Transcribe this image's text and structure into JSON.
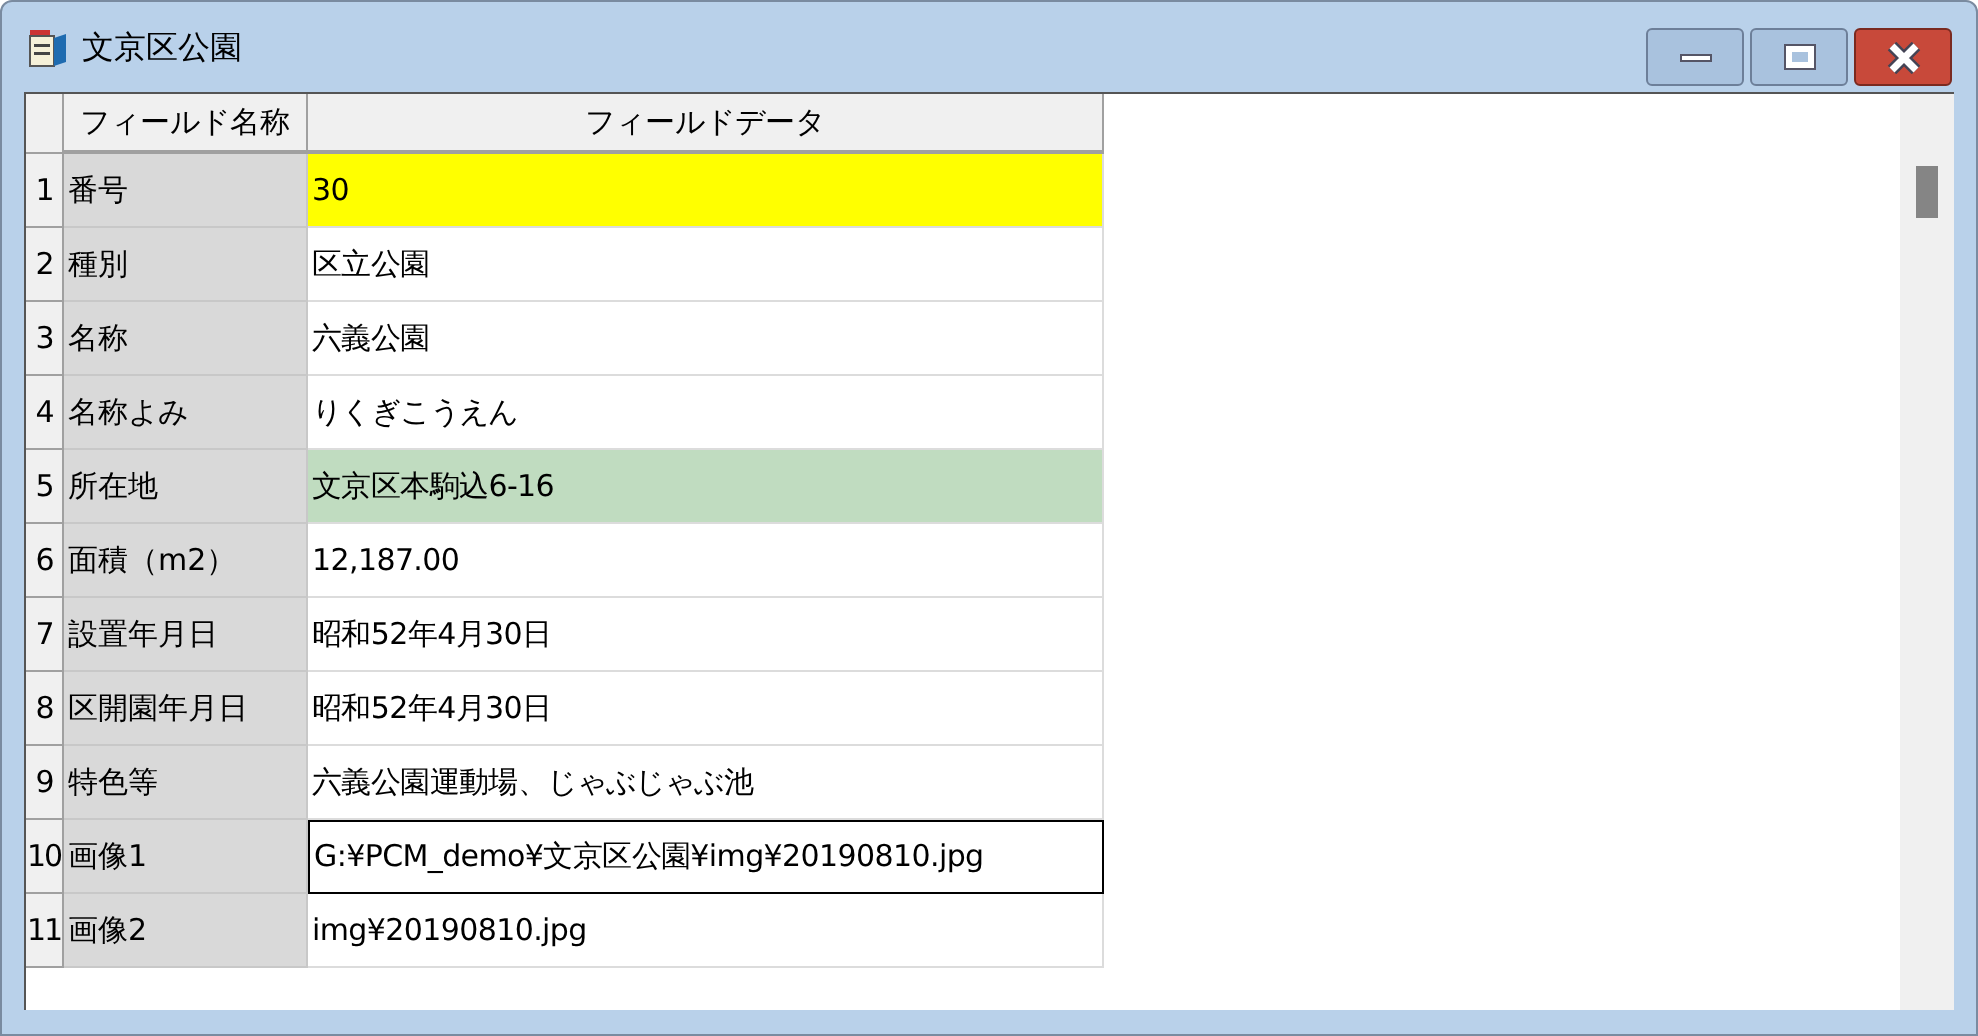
{
  "window": {
    "title": "文京区公園"
  },
  "table": {
    "columns": [
      "フィールド名称",
      "フィールドデータ"
    ],
    "rows": [
      {
        "number": "1",
        "field": "番号",
        "value": "30",
        "color": "#ffff00",
        "focused": false
      },
      {
        "number": "2",
        "field": "種別",
        "value": "区立公園",
        "focused": false
      },
      {
        "number": "3",
        "field": "名称",
        "value": "六義公園",
        "focused": false
      },
      {
        "number": "4",
        "field": "名称よみ",
        "value": "りくぎこうえん",
        "focused": false
      },
      {
        "number": "5",
        "field": "所在地",
        "value": "文京区本駒込6-16",
        "color": "#c0dcc0",
        "focused": false
      },
      {
        "number": "6",
        "field": "面積（m2）",
        "value": "12,187.00",
        "focused": false
      },
      {
        "number": "7",
        "field": "設置年月日",
        "value": "昭和52年4月30日",
        "focused": false
      },
      {
        "number": "8",
        "field": "区開園年月日",
        "value": "昭和52年4月30日",
        "focused": false
      },
      {
        "number": "9",
        "field": "特色等",
        "value": "六義公園運動場、じゃぶじゃぶ池",
        "focused": false
      },
      {
        "number": "10",
        "field": "画像1",
        "value": "G:¥PCM_demo¥文京区公園¥img¥20190810.jpg",
        "focused": true
      },
      {
        "number": "11",
        "field": "画像2",
        "value": "img¥20190810.jpg",
        "focused": false
      }
    ]
  }
}
